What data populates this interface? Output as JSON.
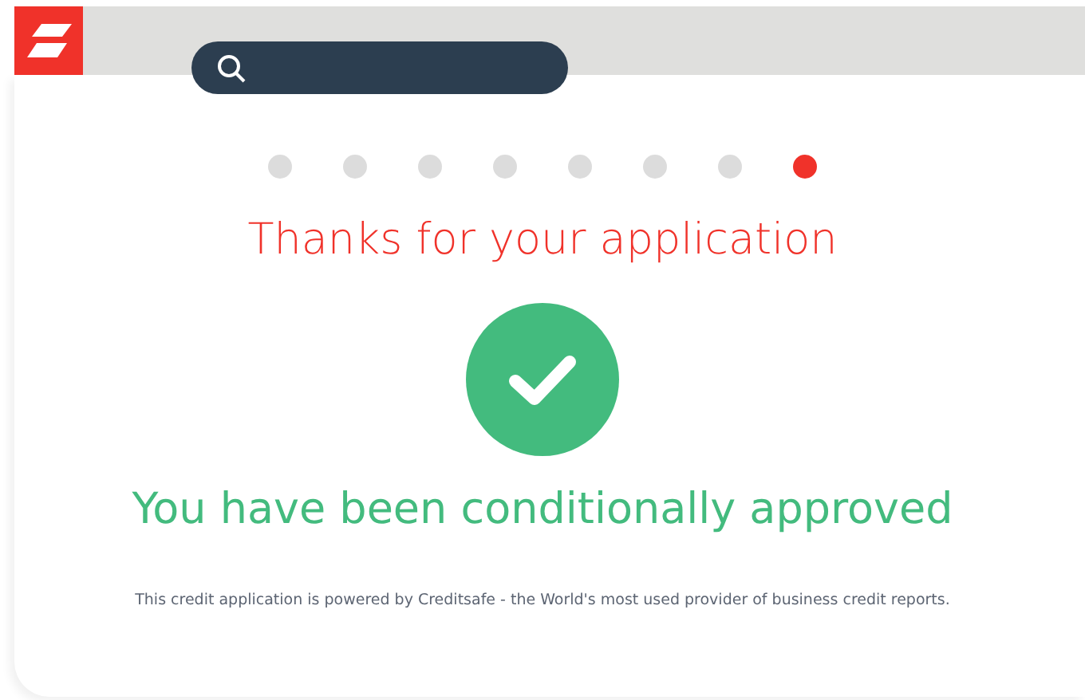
{
  "steps": [
    {
      "selected": false
    },
    {
      "selected": false
    },
    {
      "selected": false
    },
    {
      "selected": false
    },
    {
      "selected": false
    },
    {
      "selected": false
    },
    {
      "selected": false
    },
    {
      "selected": true
    }
  ],
  "title": "Thanks for your application",
  "status": {
    "kind": "approved",
    "message": "You have been conditionally approved"
  },
  "footer": "This credit application is powered by Creditsafe - the World's most used provider of business credit reports."
}
